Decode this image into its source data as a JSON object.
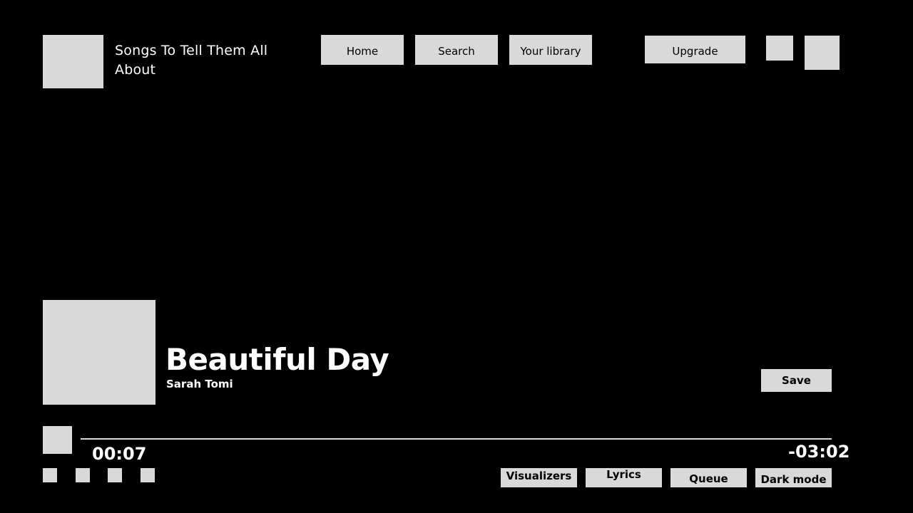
{
  "header": {
    "playlist_title": "Songs To Tell Them All About",
    "nav": {
      "home": "Home",
      "search": "Search",
      "library": "Your library",
      "upgrade": "Upgrade"
    }
  },
  "now_playing": {
    "title": "Beautiful Day",
    "artist": "Sarah Tomi",
    "save_label": "Save"
  },
  "player": {
    "elapsed": "00:07",
    "remaining": "-03:02",
    "progress_fraction": 0.0
  },
  "bottom_bar": {
    "visualizers": "Visualizers",
    "lyrics": "Lyrics",
    "queue": "Queue",
    "dark_mode": "Dark mode"
  },
  "colors": {
    "background": "#000000",
    "placeholder": "#d9d9d9",
    "text": "#ffffff"
  }
}
